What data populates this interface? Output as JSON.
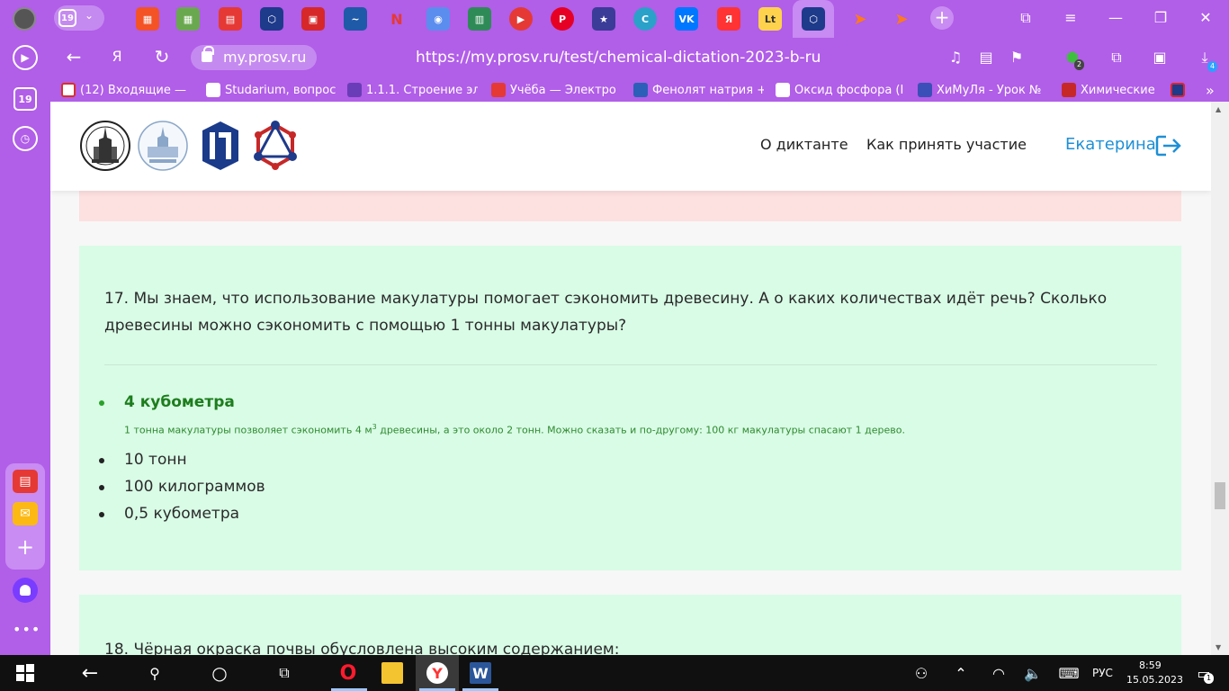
{
  "browser": {
    "tab_count": "19",
    "url_host": "my.prosv.ru",
    "url_full": "https://my.prosv.ru/test/chemical-dictation-2023-b-ru",
    "extension_badge": "2",
    "downloads_badge": "4",
    "bookmarks": [
      "(12) Входящие — ",
      "Studarium, вопрос",
      "1.1.1. Строение эл",
      "Учёба — Электро",
      "Фенолят натрия +",
      "Оксид фосфора (I",
      "ХиМуЛя - Урок №",
      "Химические"
    ]
  },
  "site": {
    "menu": {
      "about": "О диктанте",
      "how_to": "Как принять участие"
    },
    "user_name": "Екатерина"
  },
  "question17": {
    "text": "17. Мы знаем, что использование макулатуры помогает сэкономить древесину. А о каких количествах идёт речь? Сколько древесины можно сэкономить с помощью 1 тонны макулатуры?",
    "correct_answer": "4 кубометра",
    "explanation_pre": "1 тонна макулатуры позволяет сэкономить 4 м",
    "explanation_sup": "3",
    "explanation_post": " древесины, а это около 2 тонн. Можно сказать и по-другому: 100 кг макулатуры спасают 1 дерево.",
    "answers": [
      "10 тонн",
      "100 килограммов",
      "0,5 кубометра"
    ]
  },
  "question18": {
    "text": "18. Чёрная окраска почвы обусловлена высоким содержанием:"
  },
  "taskbar": {
    "language": "РУС",
    "time": "8:59",
    "date": "15.05.2023",
    "notifications": "1"
  },
  "colors": {
    "browser_purple": "#b15ee8",
    "card_green": "#d9fce6",
    "card_pink": "#fde0e0",
    "correct_green": "#1d7d1d",
    "link_blue": "#1e8fd6"
  }
}
